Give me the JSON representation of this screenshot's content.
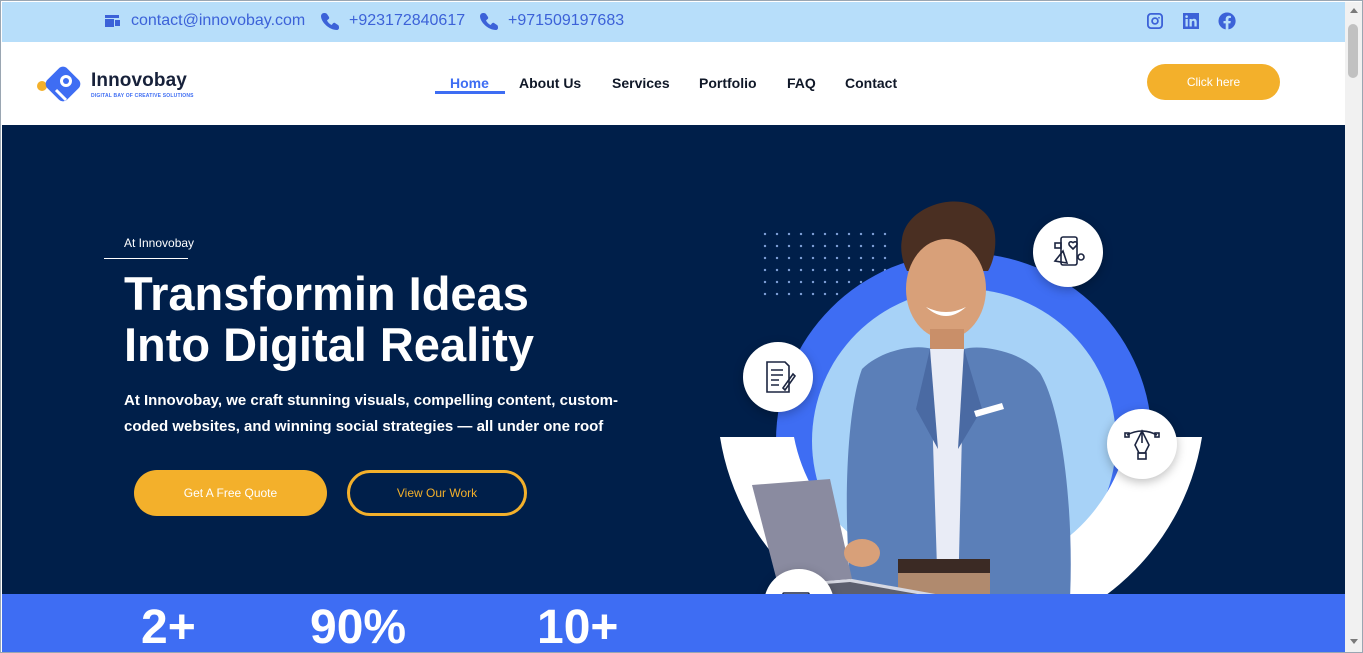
{
  "topbar": {
    "email": "contact@innovobay.com",
    "phone_1": "+923172840617",
    "phone_2": "+971509197683",
    "email_icon": "email-icon",
    "phone_icon": "phone-icon",
    "social": [
      "instagram-icon",
      "linkedin-icon",
      "facebook-icon"
    ]
  },
  "brand": {
    "name": "Innovobay",
    "tagline": "DIGITAL BAY OF CREATIVE SOLUTIONS",
    "logo_icon": "innovobay-logo-icon"
  },
  "nav": {
    "items": [
      "Home",
      "About Us",
      "Services",
      "Portfolio",
      "FAQ",
      "Contact"
    ],
    "active": "Home",
    "cta": "Click here"
  },
  "hero": {
    "eyebrow": "At Innovobay",
    "headline_line1": "Transformin Ideas",
    "headline_line2": "Into Digital Reality",
    "subtext_line1": "At Innovobay, we craft stunning visuals, compelling content, custom-",
    "subtext_line2": "coded websites, and winning social strategies — all under one roof",
    "primary_button": "Get A Free Quote",
    "secondary_button": "View Our Work",
    "badges": [
      "social-media-icon",
      "content-writing-icon",
      "graphic-design-icon",
      "web-development-icon"
    ]
  },
  "stats": {
    "values": [
      "2+",
      "90%",
      "10+"
    ]
  },
  "colors": {
    "accent_blue": "#3e6df3",
    "accent_gold": "#f3b02b",
    "hero_navy": "#001f4a",
    "topbar_blue": "#b7defa"
  }
}
